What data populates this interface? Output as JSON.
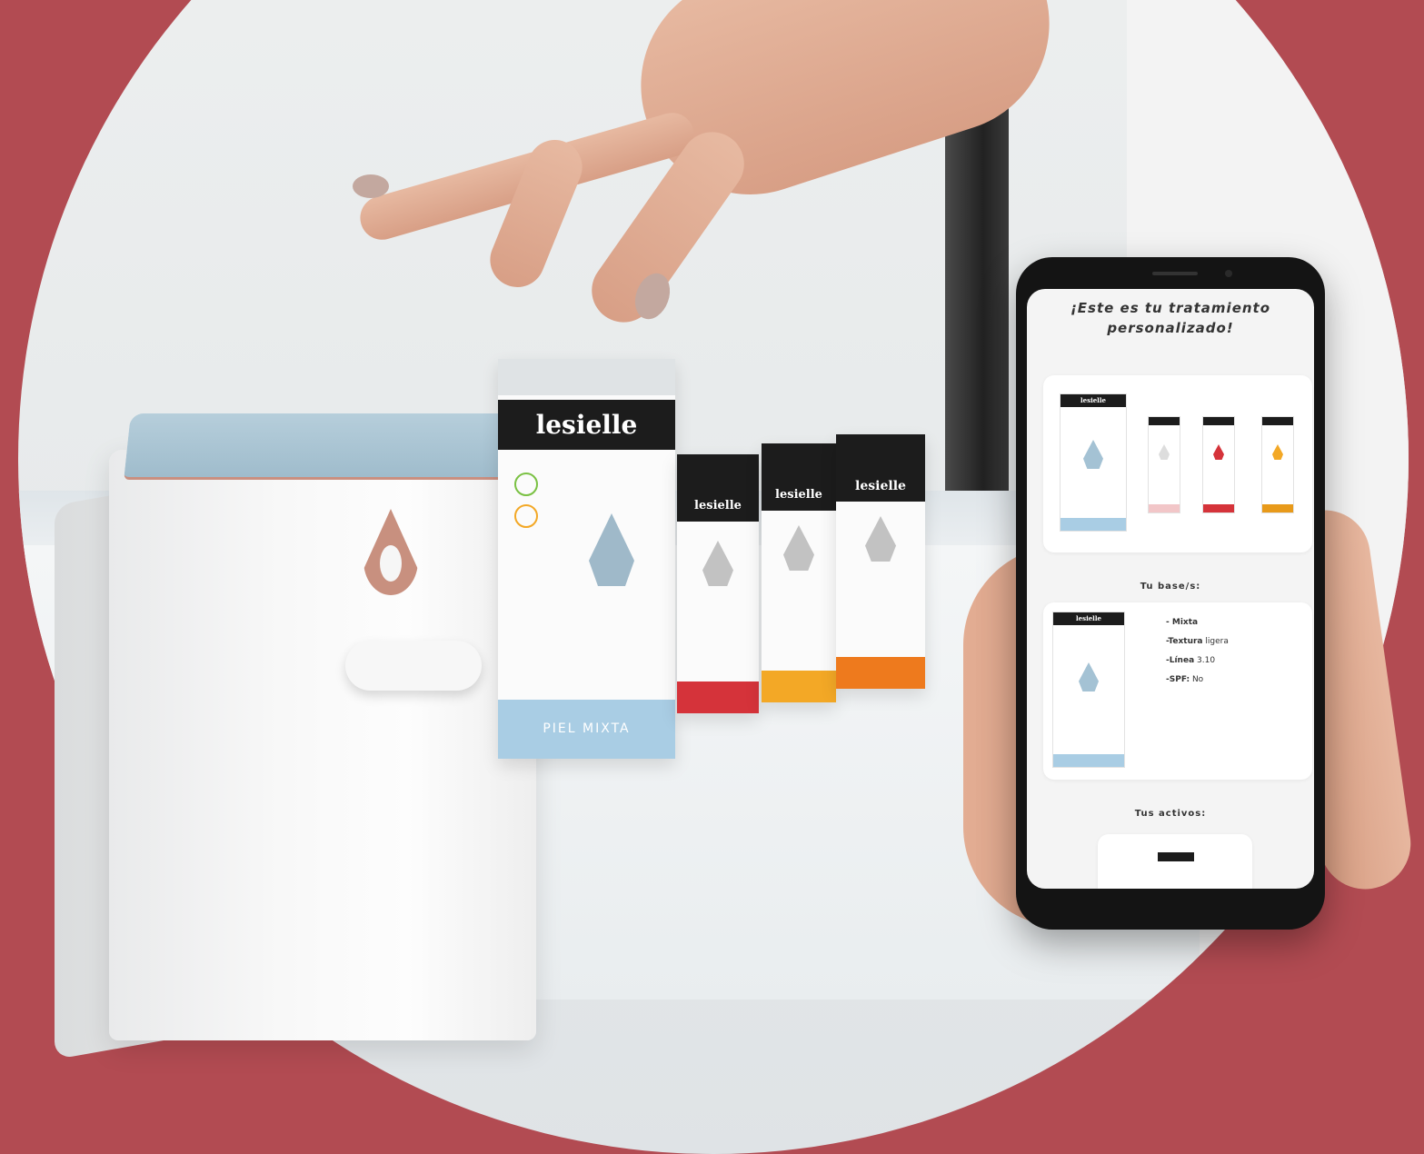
{
  "products": {
    "brand": "lesielle",
    "big_box_stripe": "PIEL MIXTA"
  },
  "phone": {
    "title_line1": "¡Este es tu tratamiento",
    "title_line2": "personalizado!",
    "base_heading": "Tu base/s:",
    "actives_heading": "Tus activos:",
    "base_card": {
      "skin_type": "- Mixta",
      "texture_key": "-Textura",
      "texture_val": "ligera",
      "line_key": "-Línea",
      "line_val": "3.10",
      "spf_key": "-SPF:",
      "spf_val": "No"
    },
    "colors": {
      "accent_blue": "#a9cde4",
      "red": "#d5333a",
      "yellow": "#f3a826",
      "orange": "#ee7a1d"
    }
  }
}
